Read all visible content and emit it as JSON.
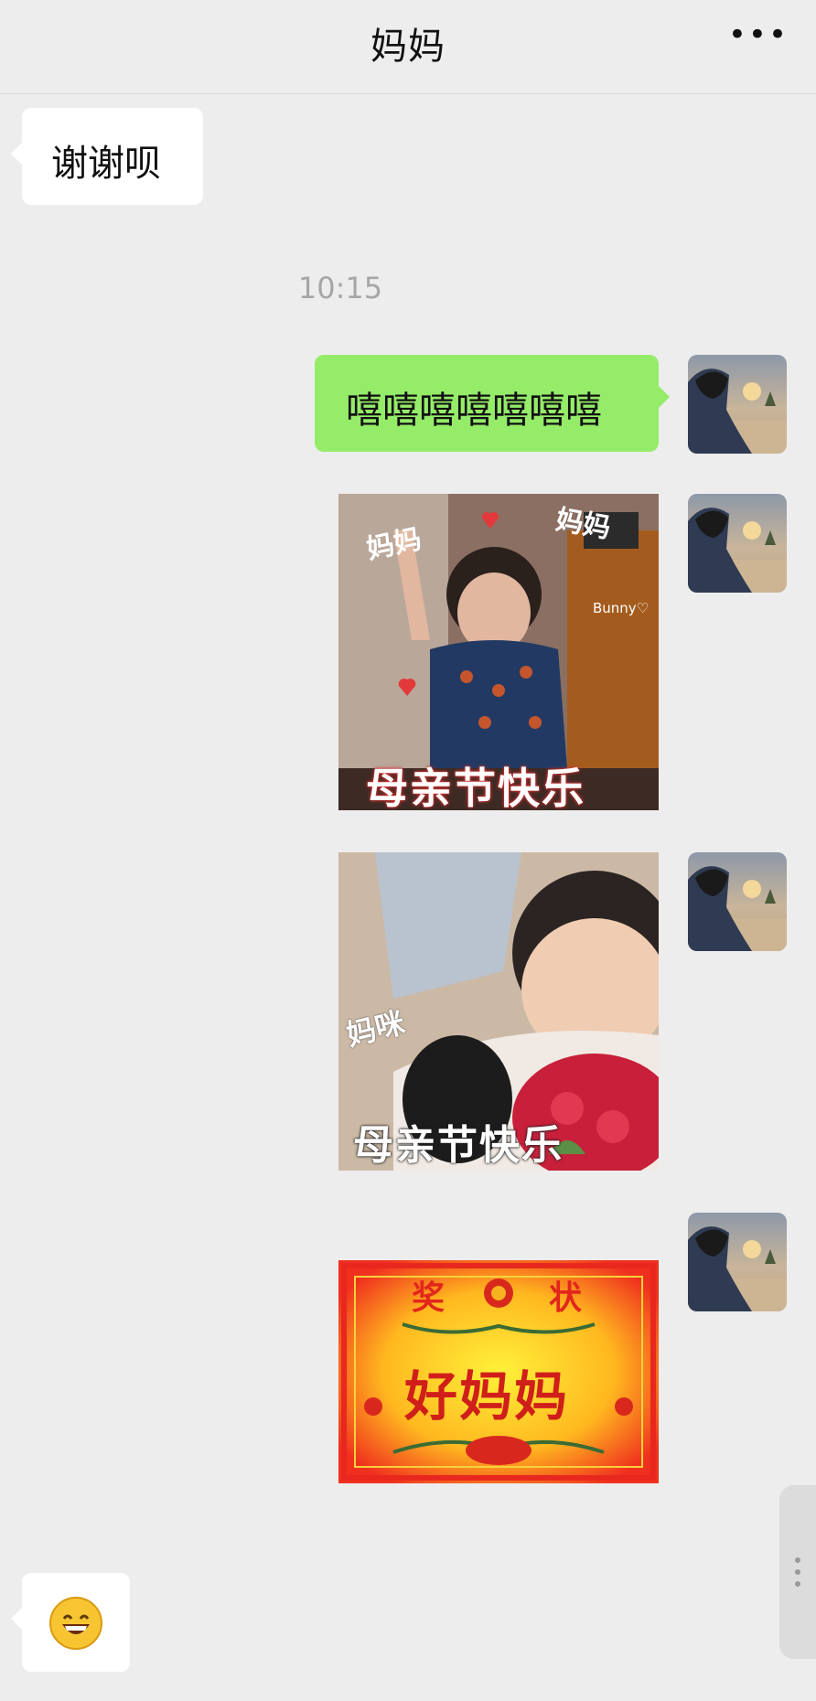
{
  "header": {
    "title": "妈妈",
    "more_icon": "more-icon",
    "more_glyph": "•••"
  },
  "messages": {
    "m1": {
      "text": "谢谢呗"
    },
    "time_1": "10:15",
    "m2": {
      "text": "嘻嘻嘻嘻嘻嘻嘻"
    },
    "sticker_1": {
      "labels": {
        "a": "妈妈",
        "b": "妈妈",
        "watermark": "Bunny♡",
        "main": "母亲节快乐"
      }
    },
    "sticker_2": {
      "labels": {
        "a": "妈咪",
        "main": "母亲节快乐"
      }
    },
    "sticker_3": {
      "labels": {
        "top_left": "奖",
        "top_right": "状",
        "main": "好妈妈"
      }
    },
    "m_emoji": {
      "emoji": "😄"
    }
  },
  "colors": {
    "background": "#ededed",
    "self_bubble": "#95ec69",
    "other_bubble": "#ffffff",
    "time_text": "#a6a6a6"
  }
}
